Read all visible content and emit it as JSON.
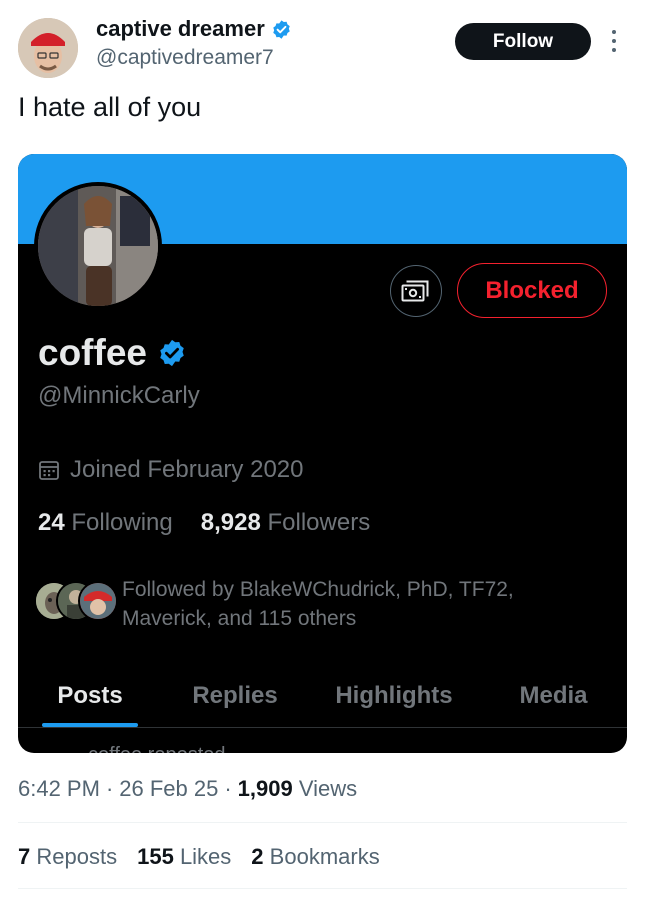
{
  "author": {
    "name": "captive dreamer",
    "handle": "@captivedreamer7",
    "follow_label": "Follow"
  },
  "tweet": {
    "text": "I hate all of you"
  },
  "profile_card": {
    "name": "coffee",
    "handle": "@MinnickCarly",
    "blocked_label": "Blocked",
    "joined": "Joined February 2020",
    "following_count": "24",
    "following_label": "Following",
    "followers_count": "8,928",
    "followers_label": "Followers",
    "followed_by": "Followed by BlakeWChudrick, PhD, TF72, Maverick, and 115 others",
    "tabs": [
      {
        "label": "Posts",
        "active": true
      },
      {
        "label": "Replies",
        "active": false
      },
      {
        "label": "Highlights",
        "active": false
      },
      {
        "label": "Media",
        "active": false
      }
    ],
    "peek_text": "coffee reposted"
  },
  "meta": {
    "time": "6:42 PM",
    "date": "26 Feb 25",
    "views_count": "1,909",
    "views_label": "Views"
  },
  "engagement": {
    "reposts_count": "7",
    "reposts_label": "Reposts",
    "likes_count": "155",
    "likes_label": "Likes",
    "bookmarks_count": "2",
    "bookmarks_label": "Bookmarks"
  },
  "colors": {
    "accent": "#1d9bf0",
    "blocked": "#f4212e",
    "card_bg": "#000000"
  }
}
